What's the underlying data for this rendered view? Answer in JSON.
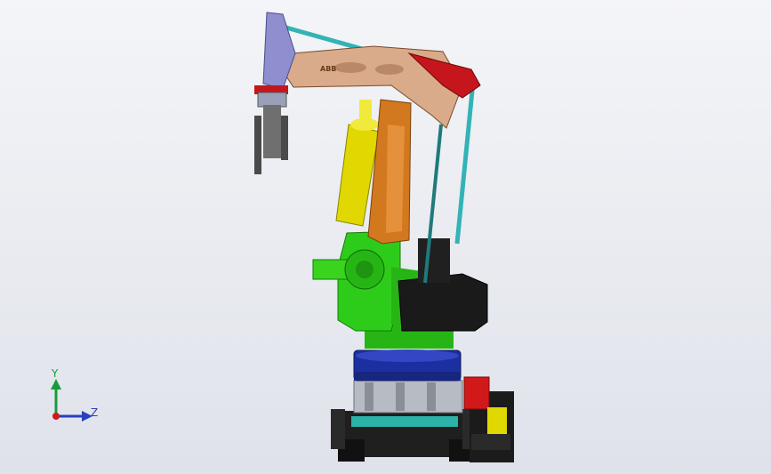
{
  "viewport": {
    "background_top": "#f4f5f8",
    "background_bottom": "#dfe2ea"
  },
  "model": {
    "object": "palletizing-robot-assembly",
    "brand_text": "ABB",
    "part_colors": {
      "upper_arm": "#d9ab8a",
      "upper_arm_cap": "#c4161c",
      "parallel_link": "#34b3b6",
      "end_effector": "#8f8fcf",
      "lower_arm": "#d2781e",
      "counterbalance": "#e0d800",
      "base_gear": "#2ecc1a",
      "motor_housing": "#1a1a1a",
      "turntable": "#1c2fa0",
      "pedestal": "#b7bcc4",
      "control_box": "#d11919"
    }
  },
  "triad": {
    "y_label": "Y",
    "z_label": "Z",
    "y_color": "#1a9a3a",
    "z_color": "#2a3fbf",
    "origin_color": "#d11919"
  }
}
